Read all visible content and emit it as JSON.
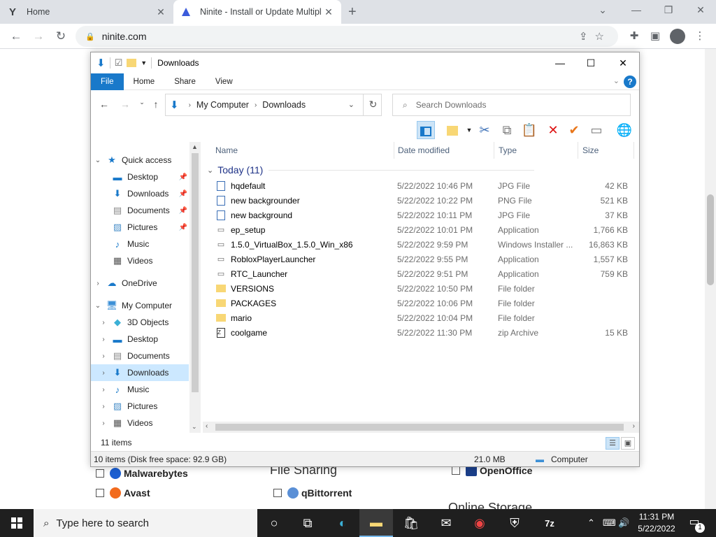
{
  "browser": {
    "tabs": [
      {
        "title": "Home",
        "favicon": "Y"
      },
      {
        "title": "Ninite - Install or Update Multipl",
        "favicon": "ninite-icon"
      }
    ],
    "url": "ninite.com"
  },
  "page_behind": {
    "checkboxes": [
      {
        "label": "Malwarebytes"
      },
      {
        "label": "Avast"
      },
      {
        "label": "qBittorrent"
      },
      {
        "label": "OpenOffice"
      }
    ],
    "sections": [
      "File Sharing",
      "Online Storage"
    ]
  },
  "explorer": {
    "title": "Downloads",
    "ribbon_tabs": [
      "File",
      "Home",
      "Share",
      "View"
    ],
    "help": "?",
    "breadcrumb": [
      "My Computer",
      "Downloads"
    ],
    "search_placeholder": "Search Downloads",
    "nav": {
      "quick_access": "Quick access",
      "quick_items": [
        "Desktop",
        "Downloads",
        "Documents",
        "Pictures",
        "Music",
        "Videos"
      ],
      "onedrive": "OneDrive",
      "my_computer": "My Computer",
      "computer_items": [
        "3D Objects",
        "Desktop",
        "Documents",
        "Downloads",
        "Music",
        "Pictures",
        "Videos"
      ]
    },
    "columns": [
      "Name",
      "Date modified",
      "Type",
      "Size"
    ],
    "group": "Today (11)",
    "files": [
      {
        "name": "hqdefault",
        "date": "5/22/2022 10:46 PM",
        "type": "JPG File",
        "size": "42 KB"
      },
      {
        "name": "new backgrounder",
        "date": "5/22/2022 10:22 PM",
        "type": "PNG File",
        "size": "521 KB"
      },
      {
        "name": "new background",
        "date": "5/22/2022 10:11 PM",
        "type": "JPG File",
        "size": "37 KB"
      },
      {
        "name": "ep_setup",
        "date": "5/22/2022 10:01 PM",
        "type": "Application",
        "size": "1,766 KB"
      },
      {
        "name": "1.5.0_VirtualBox_1.5.0_Win_x86",
        "date": "5/22/2022 9:59 PM",
        "type": "Windows Installer ...",
        "size": "16,863 KB"
      },
      {
        "name": "RobloxPlayerLauncher",
        "date": "5/22/2022 9:55 PM",
        "type": "Application",
        "size": "1,557 KB"
      },
      {
        "name": "RTC_Launcher",
        "date": "5/22/2022 9:51 PM",
        "type": "Application",
        "size": "759 KB"
      },
      {
        "name": "VERSIONS",
        "date": "5/22/2022 10:50 PM",
        "type": "File folder",
        "size": ""
      },
      {
        "name": "PACKAGES",
        "date": "5/22/2022 10:06 PM",
        "type": "File folder",
        "size": ""
      },
      {
        "name": "mario",
        "date": "5/22/2022 10:04 PM",
        "type": "File folder",
        "size": ""
      },
      {
        "name": "coolgame",
        "date": "5/22/2022 11:30 PM",
        "type": "zip Archive",
        "size": "15 KB"
      }
    ],
    "status_items": "11 items",
    "status_disk": "10 items (Disk free space: 92.9 GB)",
    "status_size": "21.0 MB",
    "status_location": "Computer"
  },
  "taskbar": {
    "search_placeholder": "Type here to search",
    "time": "11:31 PM",
    "date": "5/22/2022",
    "notifications": "1"
  },
  "colors": {
    "accent": "#1979ca",
    "selection": "#cce8ff",
    "folder": "#f8d775"
  }
}
